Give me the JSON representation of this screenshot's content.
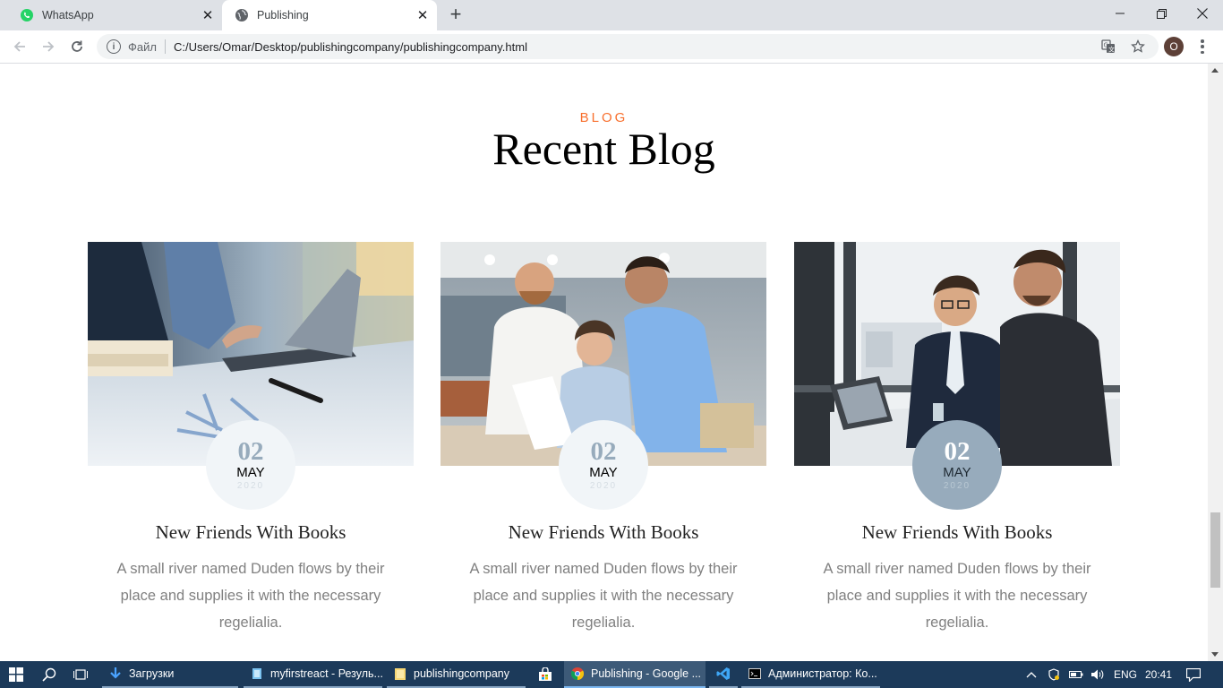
{
  "browser": {
    "tabs": [
      {
        "label": "WhatsApp",
        "active": false
      },
      {
        "label": "Publishing",
        "active": true
      }
    ],
    "address": {
      "scheme_label": "Файл",
      "url": "C:/Users/Omar/Desktop/publishingcompany/publishingcompany.html"
    },
    "profile_initial": "O"
  },
  "page": {
    "eyebrow": "BLOG",
    "heading": "Recent Blog",
    "posts": [
      {
        "day": "02",
        "month": "MAY",
        "year": "2020",
        "title": "New Friends With Books",
        "excerpt": "A small river named Duden flows by their place and supplies it with the necessary regelialia."
      },
      {
        "day": "02",
        "month": "MAY",
        "year": "2020",
        "title": "New Friends With Books",
        "excerpt": "A small river named Duden flows by their place and supplies it with the necessary regelialia."
      },
      {
        "day": "02",
        "month": "MAY",
        "year": "2020",
        "title": "New Friends With Books",
        "excerpt": "A small river named Duden flows by their place and supplies it with the necessary regelialia."
      }
    ]
  },
  "taskbar": {
    "items": [
      {
        "label": "Загрузки"
      },
      {
        "label": "myfirstreact - Резуль..."
      },
      {
        "label": "publishingcompany"
      },
      {
        "label": "Publishing - Google ..."
      },
      {
        "label": "Администратор: Ко..."
      }
    ],
    "language": "ENG",
    "clock": "20:41"
  },
  "colors": {
    "accent": "#f86f2d",
    "date_badge": "#f1f5f8",
    "date_badge_active": "#97abbc",
    "taskbar": "#1c3a5a"
  }
}
